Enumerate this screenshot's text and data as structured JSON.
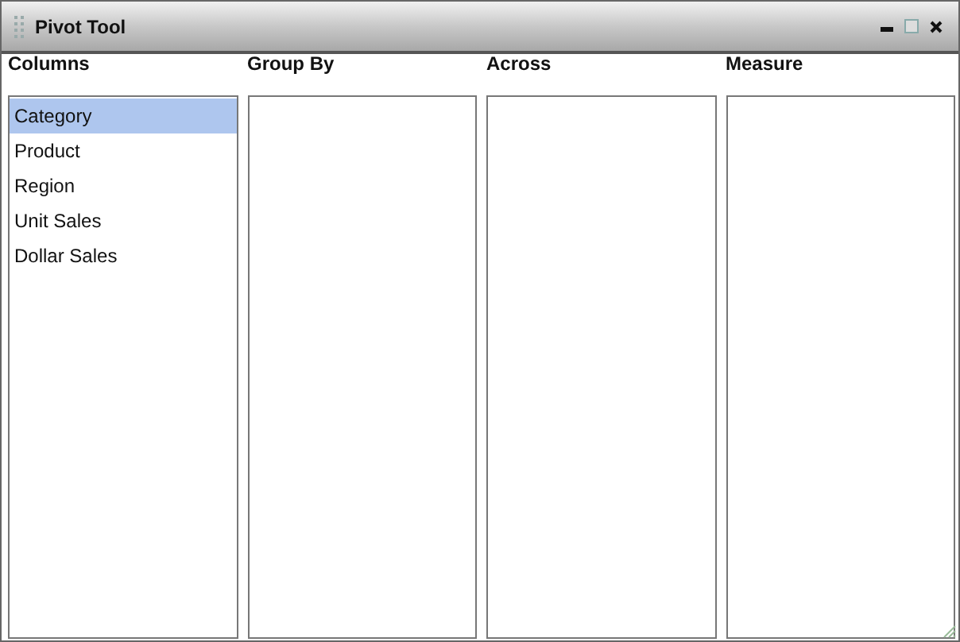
{
  "window": {
    "title": "Pivot Tool"
  },
  "panes": [
    {
      "heading": "Columns",
      "items": [
        {
          "label": "Category",
          "selected": true
        },
        {
          "label": "Product",
          "selected": false
        },
        {
          "label": "Region",
          "selected": false
        },
        {
          "label": "Unit Sales",
          "selected": false
        },
        {
          "label": "Dollar Sales",
          "selected": false
        }
      ]
    },
    {
      "heading": "Group By"
    },
    {
      "heading": "Across"
    },
    {
      "heading": "Measure"
    }
  ]
}
